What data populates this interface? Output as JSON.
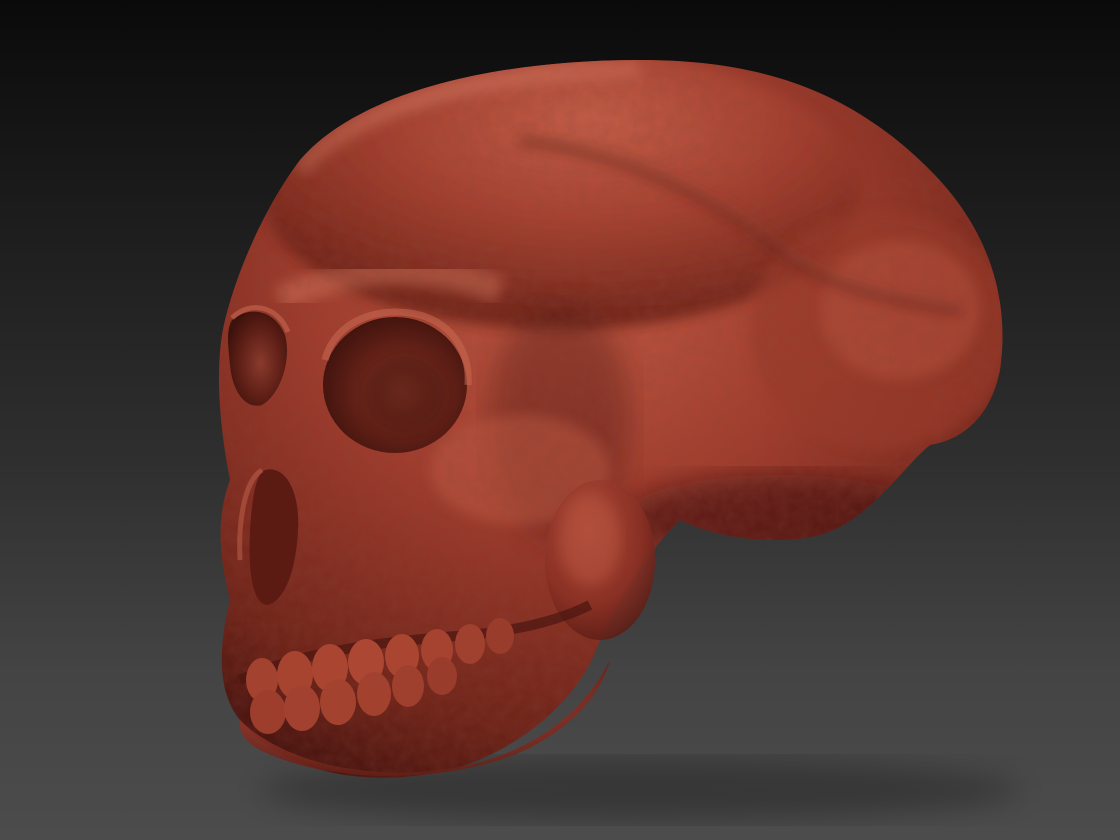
{
  "scene": {
    "subject": "sculpted-skull",
    "material_colors": {
      "base": "#9c3a2c",
      "highlight": "#c8604a",
      "shadow": "#4a1510",
      "background_top": "#0a0a0a",
      "background_bottom": "#4c4c4c"
    }
  }
}
